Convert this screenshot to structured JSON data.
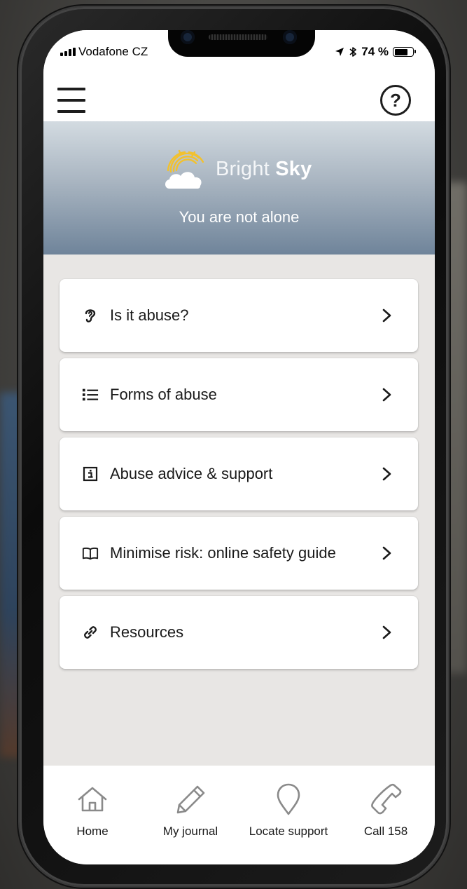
{
  "status_bar": {
    "carrier": "Vodafone CZ",
    "battery_percent": "74 %",
    "battery_level": 0.74
  },
  "header": {
    "menu_icon": "hamburger-menu-icon",
    "help_icon": "question-circle-icon",
    "help_glyph": "?"
  },
  "hero": {
    "brand_part1": "Bright",
    "brand_part2": "Sky",
    "tagline": "You are not alone",
    "logo_icon": "sun-cloud-logo"
  },
  "menu": {
    "items": [
      {
        "label": "Is it abuse?",
        "icon": "ear-icon"
      },
      {
        "label": "Forms of abuse",
        "icon": "list-icon"
      },
      {
        "label": "Abuse advice & support",
        "icon": "info-box-icon"
      },
      {
        "label": "Minimise risk: online safety guide",
        "icon": "book-icon"
      },
      {
        "label": "Resources",
        "icon": "link-icon"
      }
    ]
  },
  "tabs": [
    {
      "label": "Home",
      "icon": "home-icon"
    },
    {
      "label": "My journal",
      "icon": "pencil-icon"
    },
    {
      "label": "Locate support",
      "icon": "map-pin-icon"
    },
    {
      "label": "Call 158",
      "icon": "phone-icon"
    }
  ],
  "colors": {
    "hero_top": "#d3dbe1",
    "hero_bottom": "#6f849a",
    "logo_sun": "#f2c12e",
    "background": "#e8e6e4",
    "text": "#1a1a1a"
  }
}
